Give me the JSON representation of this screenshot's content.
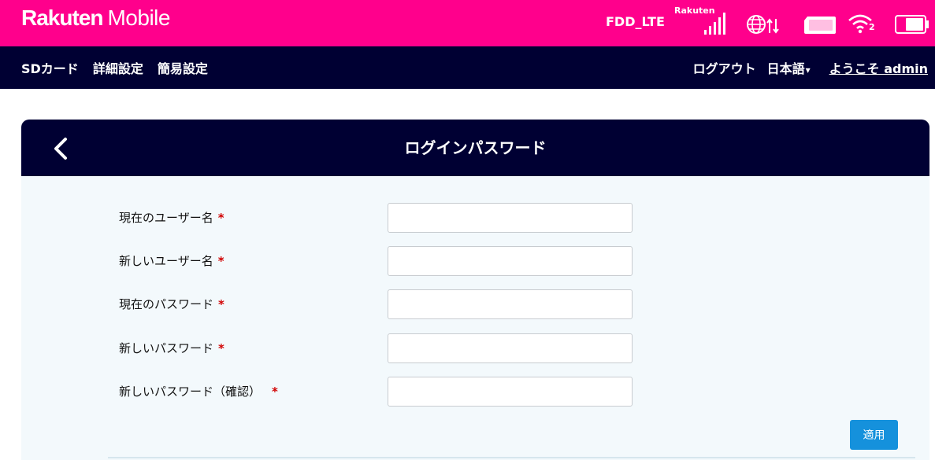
{
  "brand": {
    "logo_main": "Rakuten",
    "logo_sub": "Mobile",
    "network_type": "FDD_LTE",
    "carrier": "Rakuten",
    "wifi_clients": "2",
    "icons": [
      "signal-icon",
      "globe-icon",
      "sim-icon",
      "wifi-icon",
      "battery-icon"
    ],
    "color": "#ff008c"
  },
  "nav": {
    "left": [
      "SDカード",
      "詳細設定",
      "簡易設定"
    ],
    "logout": "ログアウト",
    "language": "日本語",
    "welcome": "ようこそ admin",
    "color": "#000033"
  },
  "card": {
    "title": "ログインパスワード",
    "back_icon": "chevron-left-icon"
  },
  "form": {
    "required_mark": "*",
    "fields": [
      {
        "label": "現在のユーザー名",
        "value": ""
      },
      {
        "label": "新しいユーザー名",
        "value": ""
      },
      {
        "label": "現在のパスワード",
        "value": ""
      },
      {
        "label": "新しいパスワード",
        "value": ""
      },
      {
        "label": "新しいパスワード（確認）",
        "value": ""
      }
    ],
    "apply_label": "適用",
    "apply_color": "#1591dc"
  }
}
